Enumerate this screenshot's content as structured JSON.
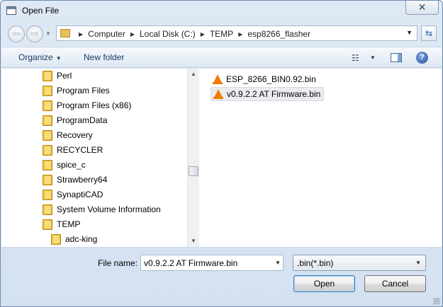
{
  "window": {
    "title": "Open File",
    "close_symbol": "✕"
  },
  "nav": {
    "back_symbol": "⇦",
    "forward_symbol": "⇨",
    "breadcrumbs": [
      "Computer",
      "Local Disk (C:)",
      "TEMP",
      "esp8266_flasher"
    ]
  },
  "toolbar": {
    "organize_label": "Organize",
    "new_folder_label": "New folder",
    "help_symbol": "?"
  },
  "tree": {
    "items": [
      {
        "label": "Perl"
      },
      {
        "label": "Program Files"
      },
      {
        "label": "Program Files (x86)"
      },
      {
        "label": "ProgramData"
      },
      {
        "label": "Recovery"
      },
      {
        "label": "RECYCLER"
      },
      {
        "label": "spice_c"
      },
      {
        "label": "Strawberry64"
      },
      {
        "label": "SynaptiCAD"
      },
      {
        "label": "System Volume Information"
      },
      {
        "label": "TEMP"
      },
      {
        "label": "adc-king"
      }
    ]
  },
  "files": [
    {
      "name": "ESP_8266_BIN0.92.bin",
      "icon": "vlc-cone-icon",
      "selected": false
    },
    {
      "name": "v0.9.2.2 AT Firmware.bin",
      "icon": "vlc-cone-icon",
      "selected": true
    }
  ],
  "footer": {
    "file_name_label": "File name:",
    "file_name_value": "v0.9.2.2 AT Firmware.bin",
    "filter_value": ".bin(*.bin)",
    "open_label": "Open",
    "cancel_label": "Cancel"
  }
}
